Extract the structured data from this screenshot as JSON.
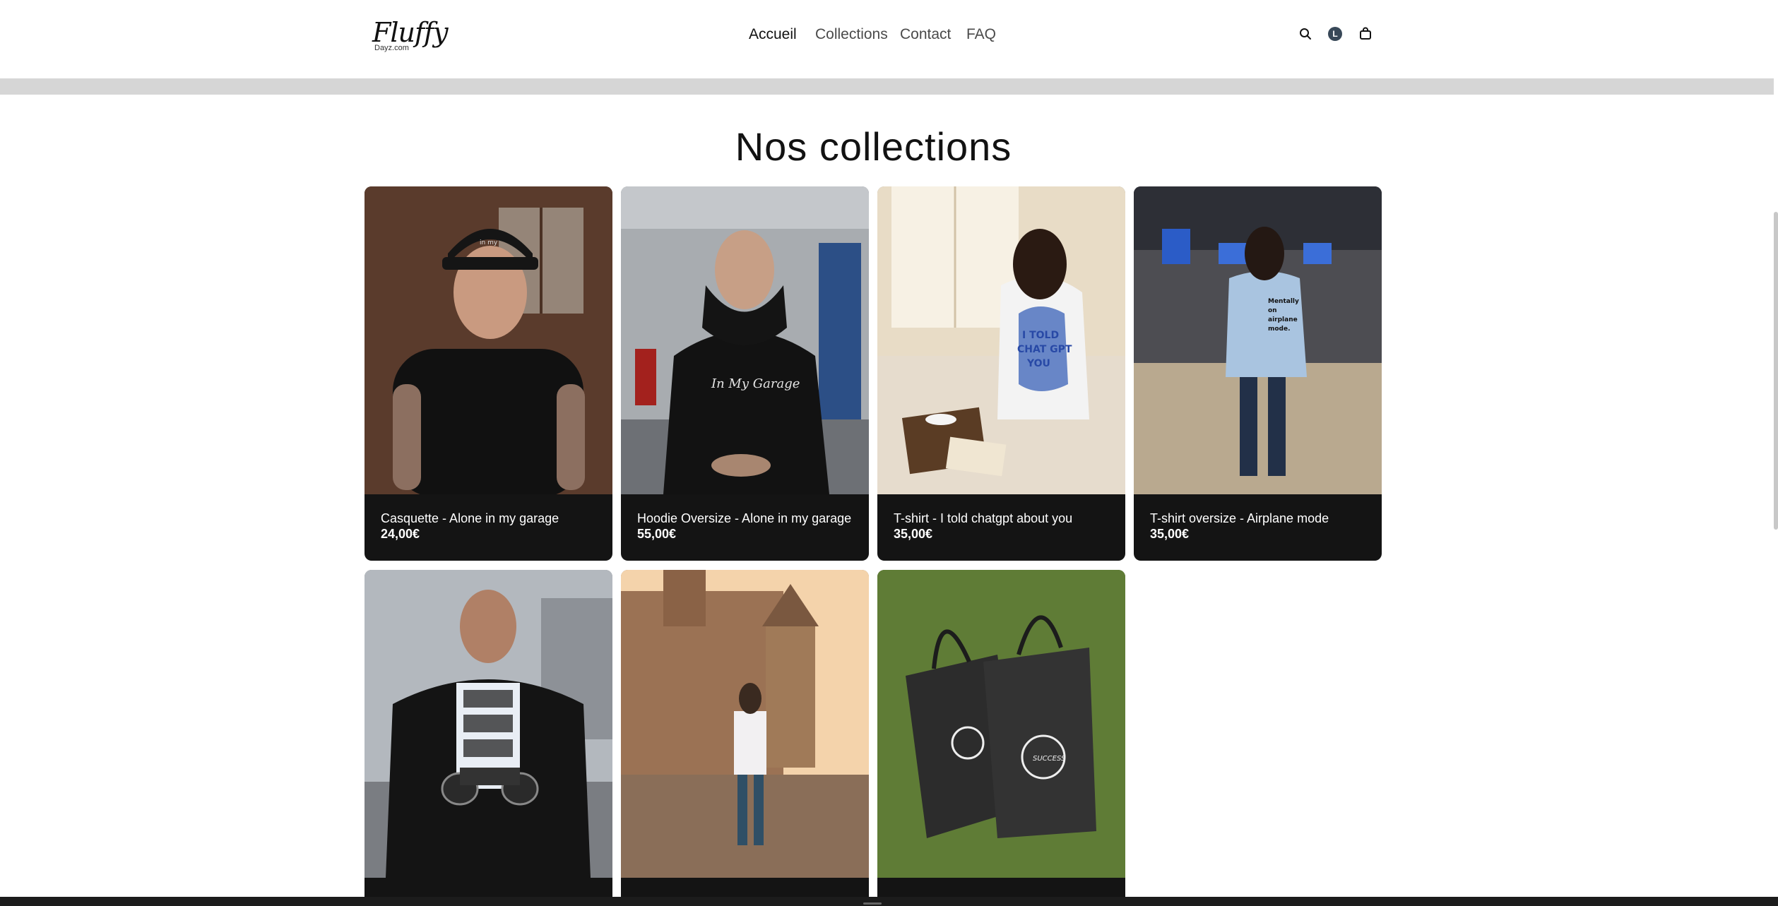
{
  "brand": {
    "logo_main": "Fluffy",
    "logo_sub": "Dayz.com"
  },
  "nav": {
    "items": [
      {
        "label": "Accueil",
        "active": true
      },
      {
        "label": "Collections",
        "active": false
      },
      {
        "label": "Contact",
        "active": false
      },
      {
        "label": "FAQ",
        "active": false
      }
    ]
  },
  "header_icons": {
    "search": "search-icon",
    "account": "account-icon",
    "account_initial": "L",
    "cart": "cart-icon"
  },
  "main": {
    "title": "Nos collections",
    "products": [
      {
        "name": "Casquette - Alone in my garage",
        "price": "24,00€"
      },
      {
        "name": "Hoodie Oversize - Alone in my garage",
        "price": "55,00€"
      },
      {
        "name": "T-shirt - I told chatgpt about you",
        "price": "35,00€"
      },
      {
        "name": "T-shirt oversize - Airplane mode",
        "price": "35,00€"
      },
      {
        "name": "",
        "price": ""
      },
      {
        "name": "",
        "price": ""
      },
      {
        "name": "",
        "price": ""
      }
    ]
  },
  "colors": {
    "card_bg": "#141414",
    "band": "#d6d6d6",
    "text": "#121212",
    "avatar": "#384858"
  }
}
